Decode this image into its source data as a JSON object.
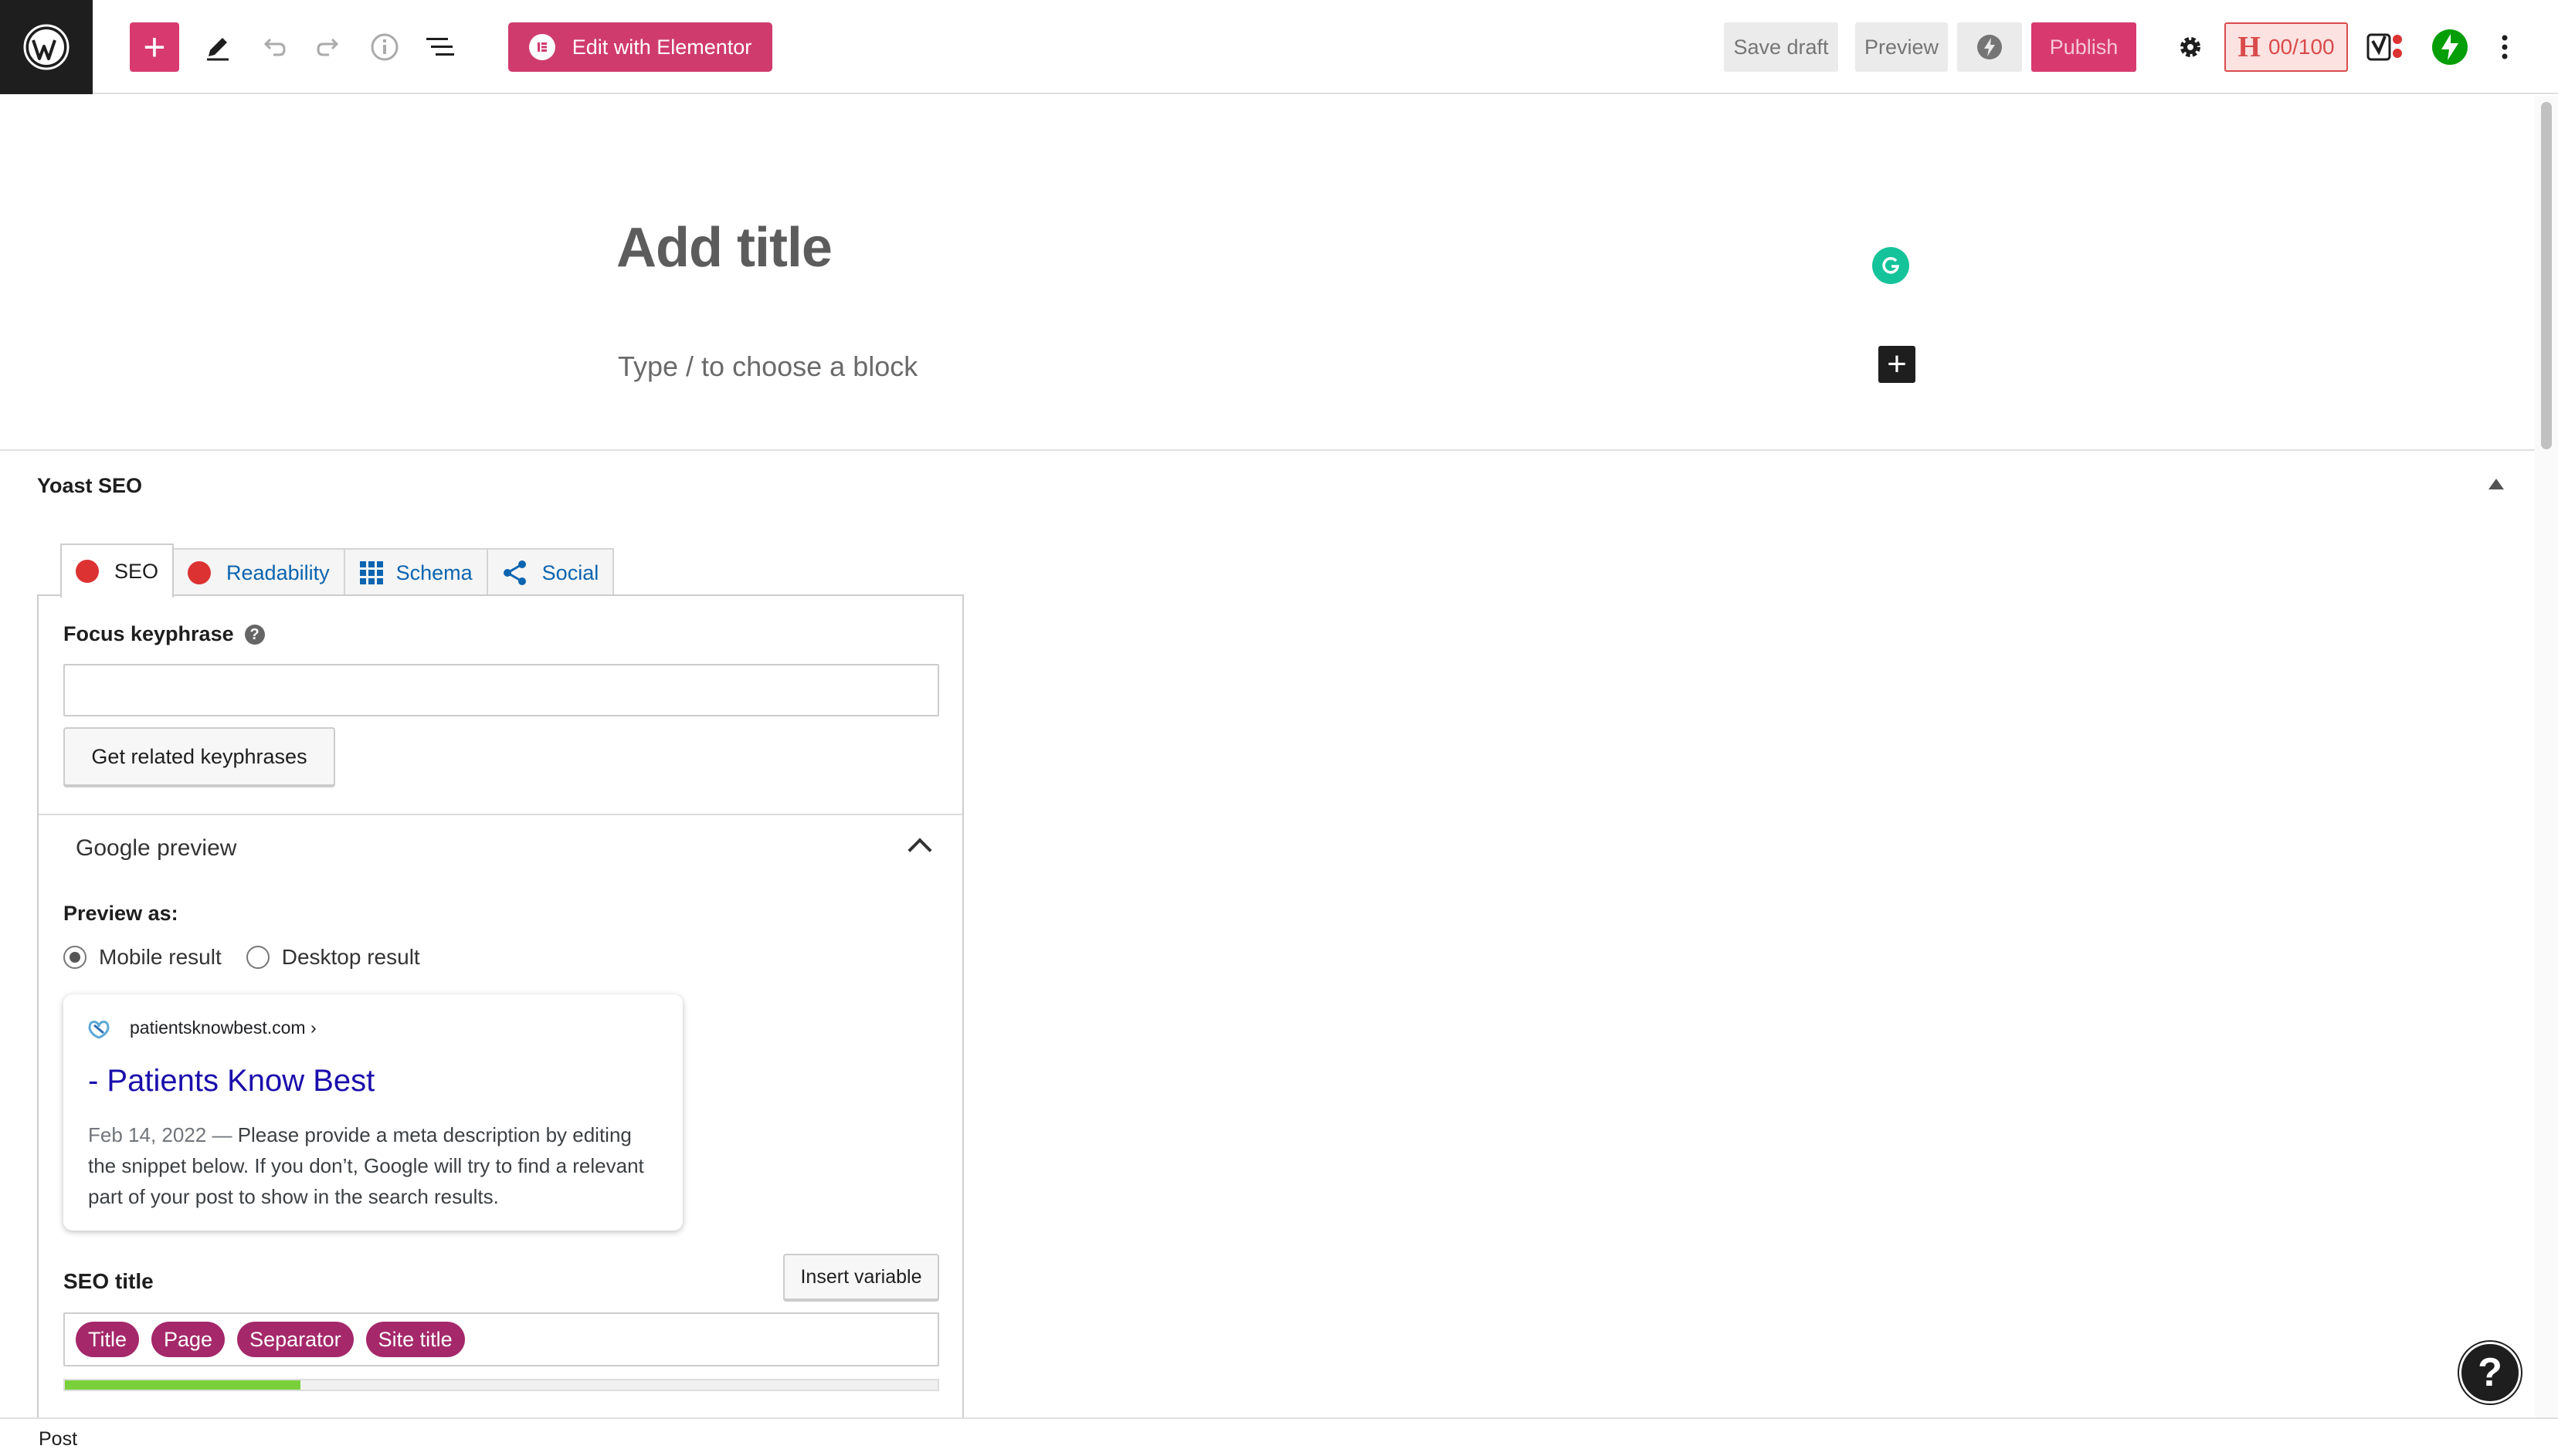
{
  "toolbar": {
    "add_block": "+",
    "elementor_label": "Edit with Elementor",
    "save_draft": "Save draft",
    "preview": "Preview",
    "publish": "Publish",
    "headline_score": "00/100",
    "headline_score_letter": "H",
    "colors": {
      "accent": "#d83a6f",
      "dark": "#1e1e1e"
    }
  },
  "editor": {
    "title_placeholder": "Add title",
    "block_placeholder": "Type / to choose a block",
    "block_add": "+"
  },
  "yoast": {
    "panel_title": "Yoast SEO",
    "tabs": [
      {
        "label": "SEO",
        "icon": "red-dot-icon"
      },
      {
        "label": "Readability",
        "icon": "red-dot-icon"
      },
      {
        "label": "Schema",
        "icon": "grid-icon"
      },
      {
        "label": "Social",
        "icon": "share-icon"
      }
    ],
    "focus_keyphrase_label": "Focus keyphrase",
    "focus_keyphrase_value": "",
    "related_keyphrases_button": "Get related keyphrases",
    "google_preview_title": "Google preview",
    "preview_as_label": "Preview as:",
    "mobile_result": "Mobile result",
    "desktop_result": "Desktop result",
    "selected_preview": "Mobile result",
    "serp": {
      "url": "patientsknowbest.com ›",
      "title": "- Patients Know Best",
      "date": "Feb 14, 2022",
      "separator": " — ",
      "description": "Please provide a meta description by editing the snippet below. If you don’t, Google will try to find a relevant part of your post to show in the search results."
    },
    "seo_title_label": "SEO title",
    "insert_variable_button": "Insert variable",
    "seo_title_pills": [
      "Title",
      "Page",
      "Separator",
      "Site title"
    ],
    "seo_title_progress": 0.27
  },
  "help_button": "?",
  "footer": {
    "breadcrumb": "Post"
  }
}
